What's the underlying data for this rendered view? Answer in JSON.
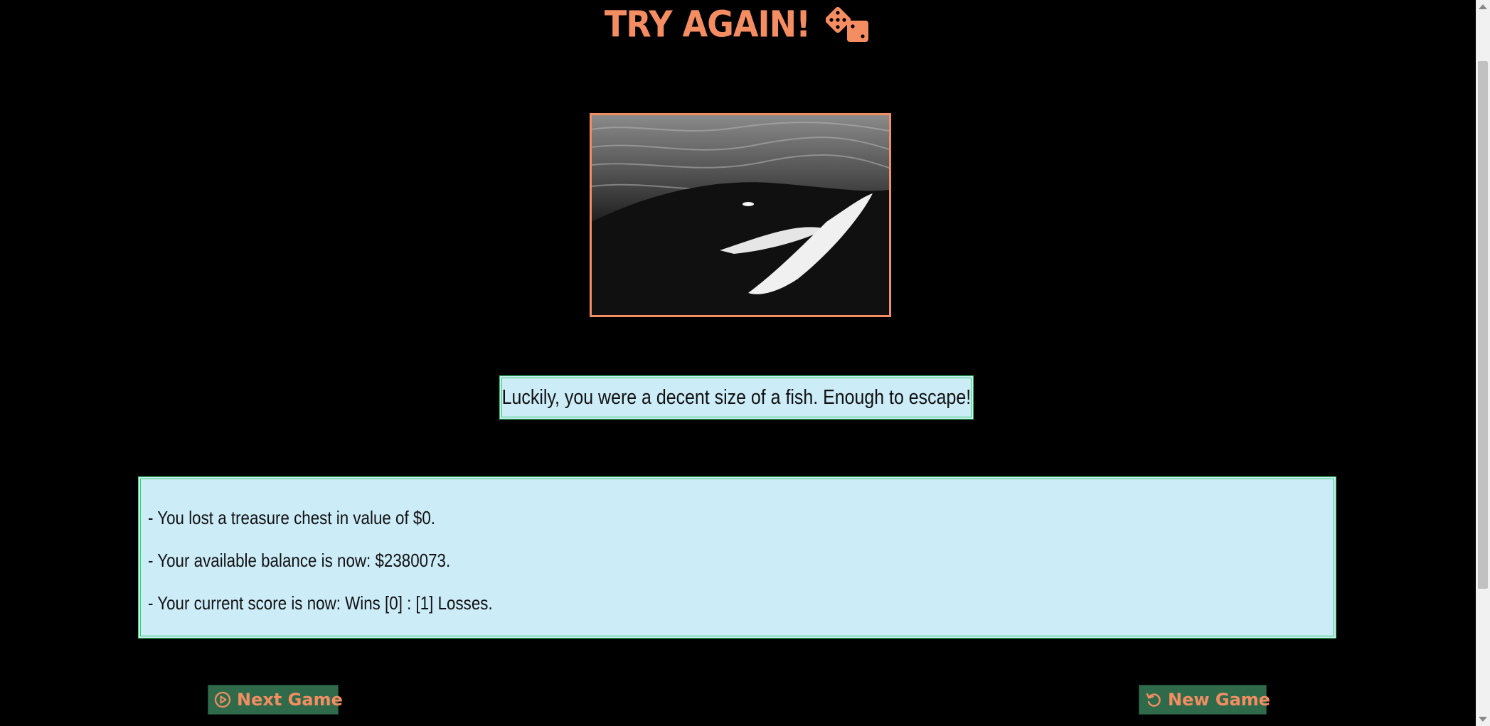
{
  "header": {
    "title": "TRY AGAIN!",
    "icon": "dice-icon"
  },
  "result_image": {
    "subject": "orca-underwater",
    "border_color": "#f58d62"
  },
  "message": {
    "text": "Luckily, you were a decent size of a fish. Enough to escape!"
  },
  "results": {
    "lines": [
      "- You lost a treasure chest in value of $0.",
      "- Your available balance is now: $2380073.",
      "- Your current score is now: Wins [0] : [1] Losses."
    ]
  },
  "buttons": {
    "next_game": {
      "label": "Next Game",
      "icon": "play-circle-icon"
    },
    "new_game": {
      "label": "New Game",
      "icon": "restart-icon"
    }
  },
  "colors": {
    "accent": "#f58d62",
    "panel_bg": "#ccecf8",
    "panel_border": "#33cc66",
    "button_bg": "#2f6b4a",
    "page_bg": "#000000"
  }
}
